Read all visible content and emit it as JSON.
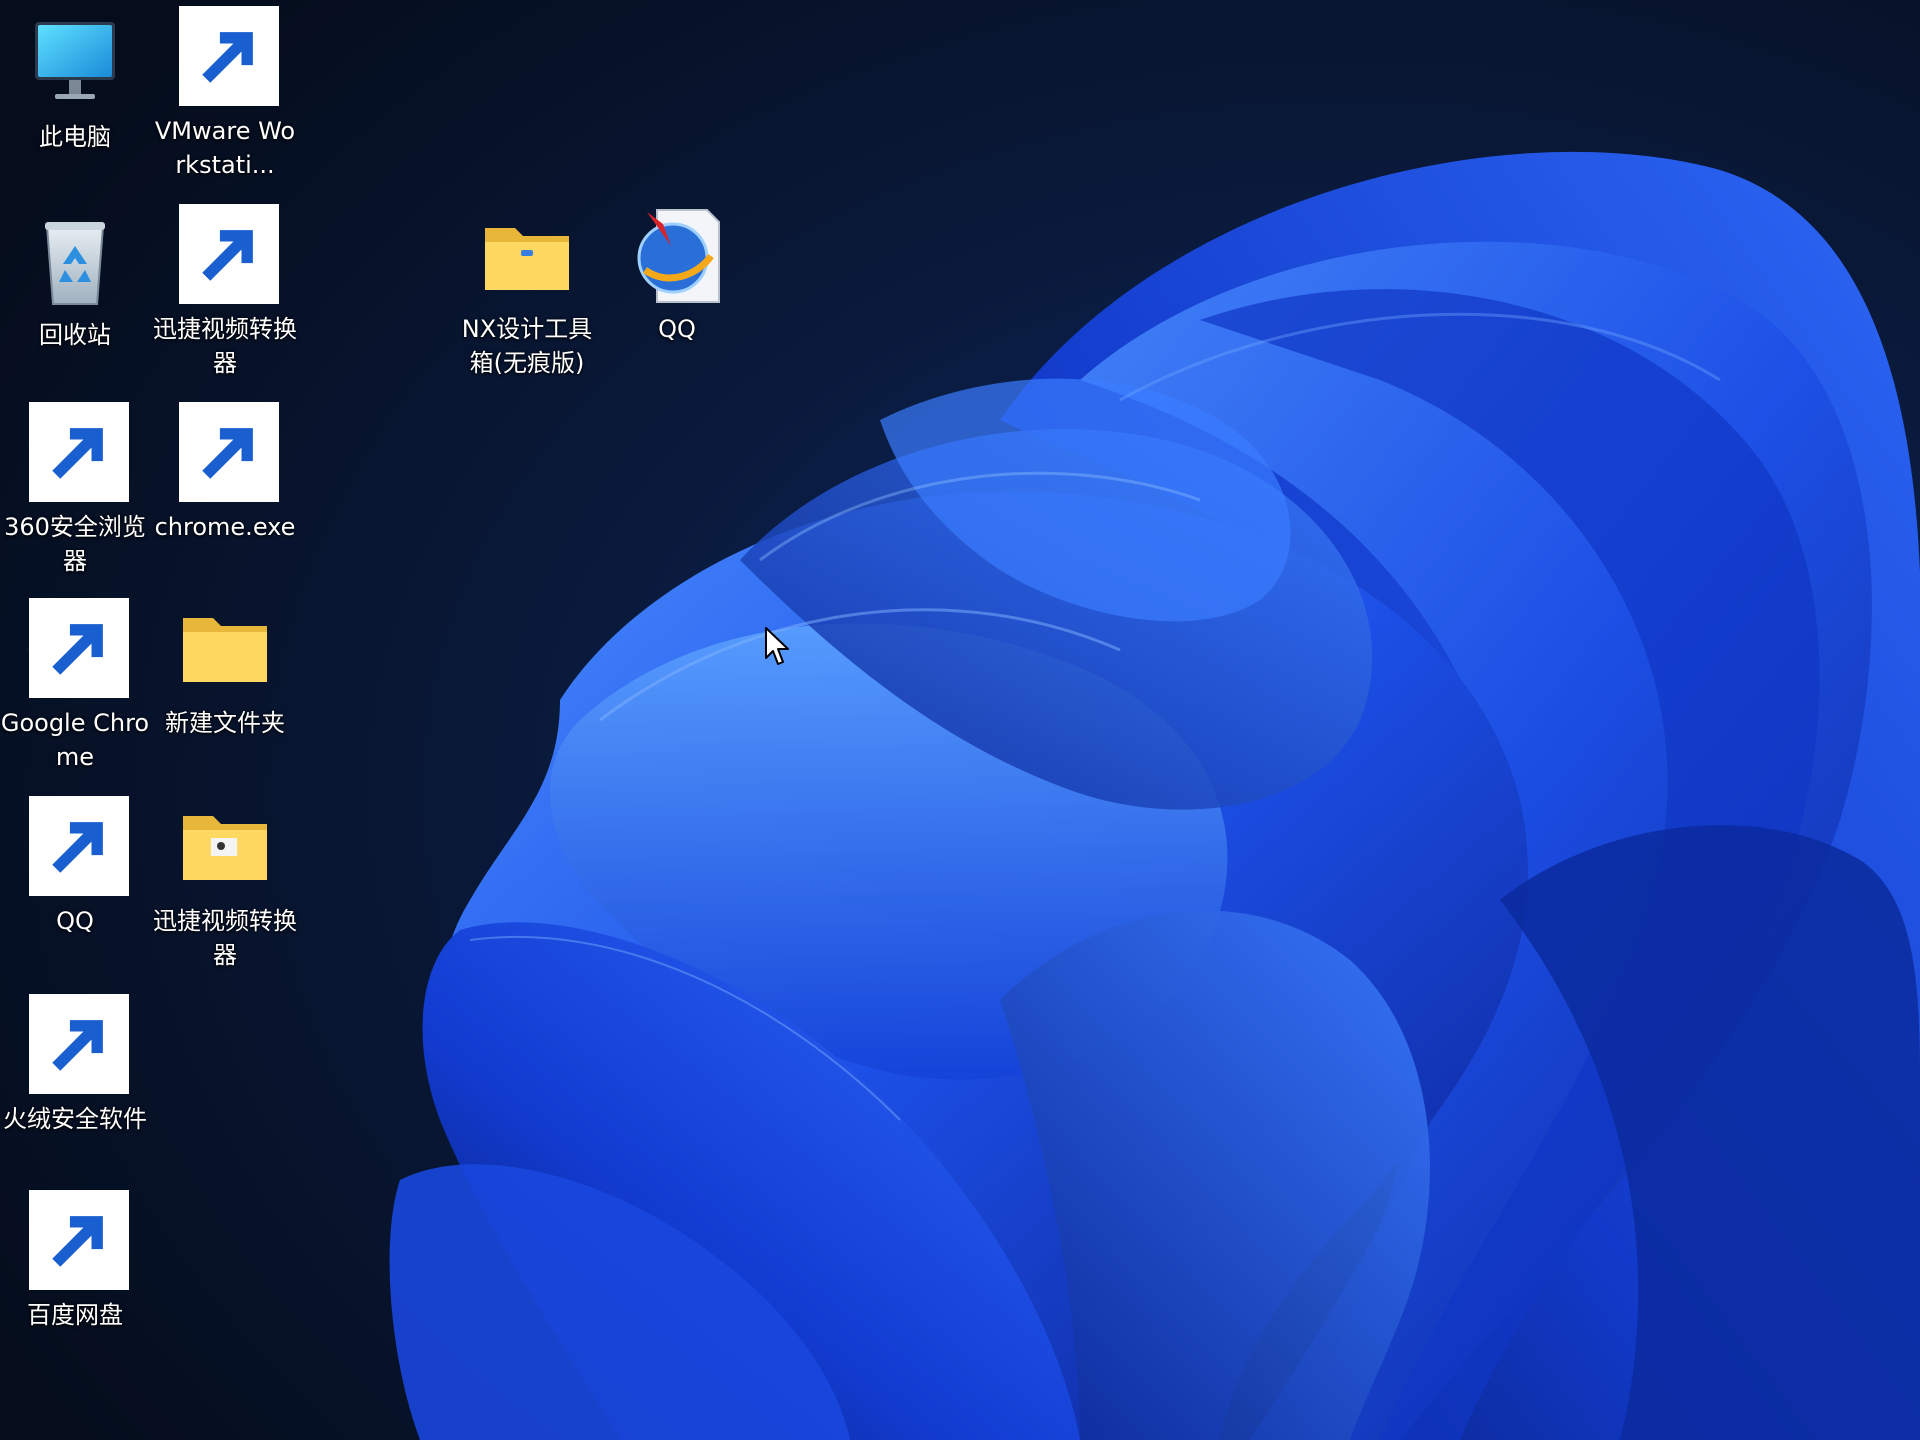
{
  "desktop": {
    "icons": [
      {
        "label": "此电脑",
        "icon": "monitor-icon",
        "shortcut": false
      },
      {
        "label": "VMware Workstati...",
        "icon": "vmware-icon",
        "shortcut": true
      },
      {
        "label": "回收站",
        "icon": "recycle-bin-icon",
        "shortcut": false
      },
      {
        "label": "迅捷视频转换器",
        "icon": "video-converter-icon",
        "shortcut": true
      },
      {
        "label": "NX设计工具箱(无痕版)",
        "icon": "folder-icon",
        "shortcut": false
      },
      {
        "label": "QQ",
        "icon": "qq-globe-icon",
        "shortcut": false
      },
      {
        "label": "360安全浏览器",
        "icon": "360-browser-icon",
        "shortcut": true
      },
      {
        "label": "chrome.exe",
        "icon": "chrome-exe-icon",
        "shortcut": true
      },
      {
        "label": "Google Chrome",
        "icon": "google-chrome-icon",
        "shortcut": true
      },
      {
        "label": "新建文件夹",
        "icon": "folder-icon",
        "shortcut": false
      },
      {
        "label": "QQ",
        "icon": "qq-penguin-icon",
        "shortcut": true
      },
      {
        "label": "迅捷视频转换器",
        "icon": "folder-icon",
        "shortcut": false
      },
      {
        "label": "火绒安全软件",
        "icon": "huorong-shield-icon",
        "shortcut": true
      },
      {
        "label": "百度网盘",
        "icon": "baidu-netdisk-icon",
        "shortcut": true
      }
    ]
  },
  "colors": {
    "wallpaper_bg": "#061021",
    "bloom_blue": "#1d4fe8",
    "label_text": "#ffffff"
  }
}
